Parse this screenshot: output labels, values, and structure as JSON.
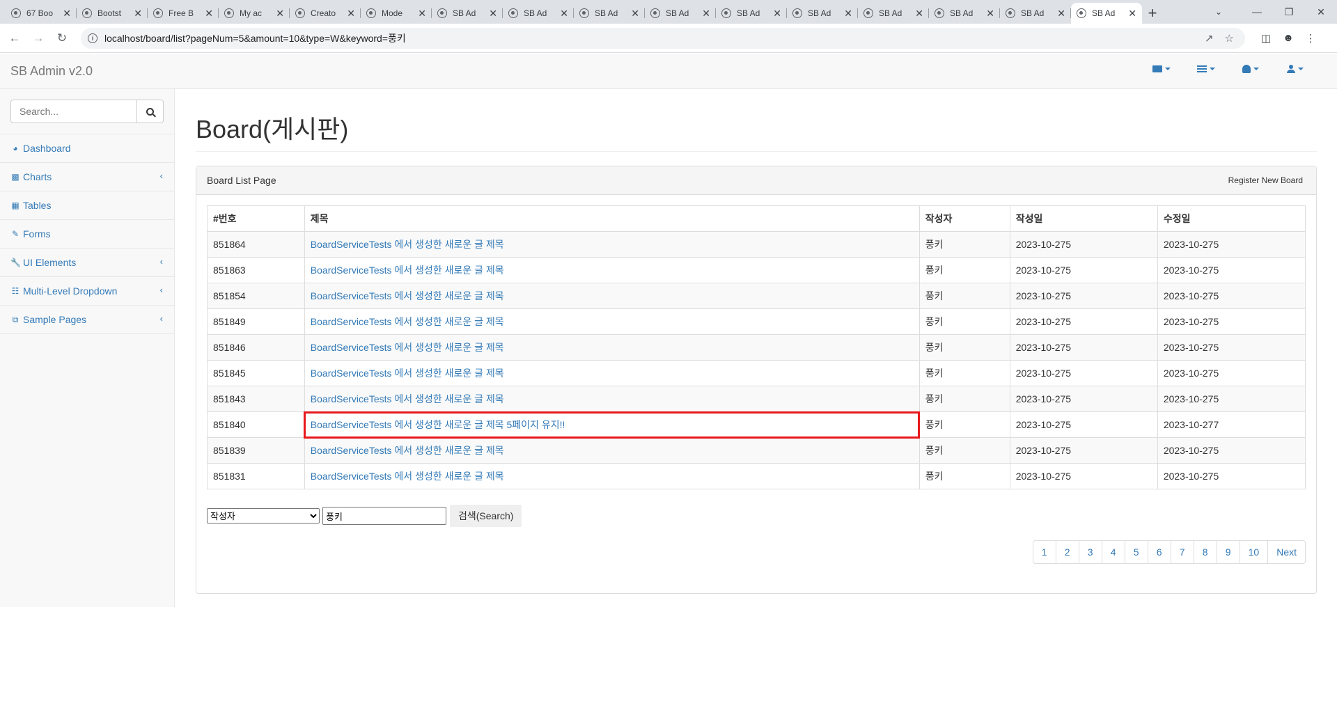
{
  "browser": {
    "tabs": [
      {
        "label": "67 Boo"
      },
      {
        "label": "Bootst"
      },
      {
        "label": "Free B"
      },
      {
        "label": "My ac"
      },
      {
        "label": "Creato"
      },
      {
        "label": "Mode"
      },
      {
        "label": "SB Ad"
      },
      {
        "label": "SB Ad"
      },
      {
        "label": "SB Ad"
      },
      {
        "label": "SB Ad"
      },
      {
        "label": "SB Ad"
      },
      {
        "label": "SB Ad"
      },
      {
        "label": "SB Ad"
      },
      {
        "label": "SB Ad"
      },
      {
        "label": "SB Ad"
      },
      {
        "label": "SB Ad"
      }
    ],
    "url": "localhost/board/list?pageNum=5&amount=10&type=W&keyword=풍키"
  },
  "app": {
    "brand": "SB Admin v2.0"
  },
  "sidebar": {
    "search_placeholder": "Search...",
    "items": [
      {
        "label": "Dashboard",
        "icon": "dashboard-icon",
        "has_arrow": false
      },
      {
        "label": "Charts",
        "icon": "bar-chart-icon",
        "has_arrow": true
      },
      {
        "label": "Tables",
        "icon": "table-icon",
        "has_arrow": false
      },
      {
        "label": "Forms",
        "icon": "edit-icon",
        "has_arrow": false
      },
      {
        "label": "UI Elements",
        "icon": "wrench-icon",
        "has_arrow": true
      },
      {
        "label": "Multi-Level Dropdown",
        "icon": "sitemap-icon",
        "has_arrow": true
      },
      {
        "label": "Sample Pages",
        "icon": "files-icon",
        "has_arrow": true
      }
    ]
  },
  "main": {
    "title": "Board(게시판)",
    "panel_heading": "Board List Page",
    "register_button": "Register New Board",
    "columns": [
      "#번호",
      "제목",
      "작성자",
      "작성일",
      "수정일"
    ],
    "rows": [
      {
        "no": "851864",
        "title": "BoardServiceTests 에서 생성한 새로운 글 제목",
        "writer": "풍키",
        "regdate": "2023-10-275",
        "updatedate": "2023-10-275"
      },
      {
        "no": "851863",
        "title": "BoardServiceTests 에서 생성한 새로운 글 제목",
        "writer": "풍키",
        "regdate": "2023-10-275",
        "updatedate": "2023-10-275"
      },
      {
        "no": "851854",
        "title": "BoardServiceTests 에서 생성한 새로운 글 제목",
        "writer": "풍키",
        "regdate": "2023-10-275",
        "updatedate": "2023-10-275"
      },
      {
        "no": "851849",
        "title": "BoardServiceTests 에서 생성한 새로운 글 제목",
        "writer": "풍키",
        "regdate": "2023-10-275",
        "updatedate": "2023-10-275"
      },
      {
        "no": "851846",
        "title": "BoardServiceTests 에서 생성한 새로운 글 제목",
        "writer": "풍키",
        "regdate": "2023-10-275",
        "updatedate": "2023-10-275"
      },
      {
        "no": "851845",
        "title": "BoardServiceTests 에서 생성한 새로운 글 제목",
        "writer": "풍키",
        "regdate": "2023-10-275",
        "updatedate": "2023-10-275"
      },
      {
        "no": "851843",
        "title": "BoardServiceTests 에서 생성한 새로운 글 제목",
        "writer": "풍키",
        "regdate": "2023-10-275",
        "updatedate": "2023-10-275"
      },
      {
        "no": "851840",
        "title": "BoardServiceTests 에서 생성한 새로운 글 제목 5페이지 유지!!",
        "writer": "풍키",
        "regdate": "2023-10-275",
        "updatedate": "2023-10-277",
        "highlighted": true
      },
      {
        "no": "851839",
        "title": "BoardServiceTests 에서 생성한 새로운 글 제목",
        "writer": "풍키",
        "regdate": "2023-10-275",
        "updatedate": "2023-10-275"
      },
      {
        "no": "851831",
        "title": "BoardServiceTests 에서 생성한 새로운 글 제목",
        "writer": "풍키",
        "regdate": "2023-10-275",
        "updatedate": "2023-10-275"
      }
    ],
    "search": {
      "type_selected": "작성자",
      "keyword": "풍키",
      "button": "검색(Search)"
    },
    "pagination": [
      "1",
      "2",
      "3",
      "4",
      "5",
      "6",
      "7",
      "8",
      "9",
      "10",
      "Next"
    ],
    "highlight_color": "#e8171b"
  }
}
